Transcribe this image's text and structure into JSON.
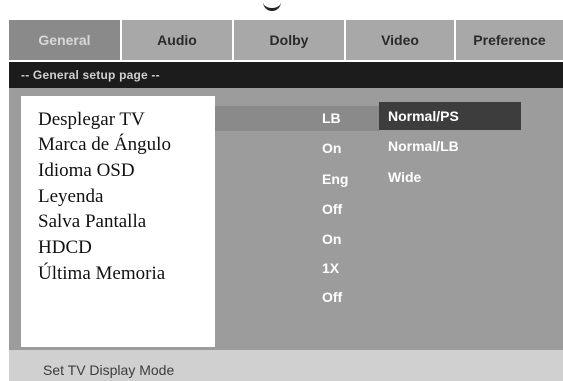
{
  "tabs": [
    {
      "label": "General",
      "active": true
    },
    {
      "label": "Audio",
      "active": false
    },
    {
      "label": "Dolby",
      "active": false
    },
    {
      "label": "Video",
      "active": false
    },
    {
      "label": "Preference",
      "active": false
    }
  ],
  "page_title": "-- General setup page --",
  "settings": [
    {
      "label": "Desplegar TV",
      "value": "LB"
    },
    {
      "label": "Marca de Ángulo",
      "value": "On"
    },
    {
      "label": "Idioma OSD",
      "value": "Eng"
    },
    {
      "label": "Leyenda",
      "value": "Off"
    },
    {
      "label": "Salva Pantalla",
      "value": "On"
    },
    {
      "label": "HDCD",
      "value": "1X"
    },
    {
      "label": "Última Memoria",
      "value": "Off"
    }
  ],
  "options": [
    "Normal/PS",
    "Normal/LB",
    "Wide"
  ],
  "status_text": "Set TV Display Mode",
  "colors": {
    "tab_active_bg": "#8a8a8a",
    "tab_inactive_bg": "#a8a8a8",
    "title_bar_bg": "#1c1c1c",
    "panel_bg": "#9c9c9c",
    "option_highlight_bg": "#3d3d3d",
    "status_bar_bg": "#d0d0d0"
  }
}
